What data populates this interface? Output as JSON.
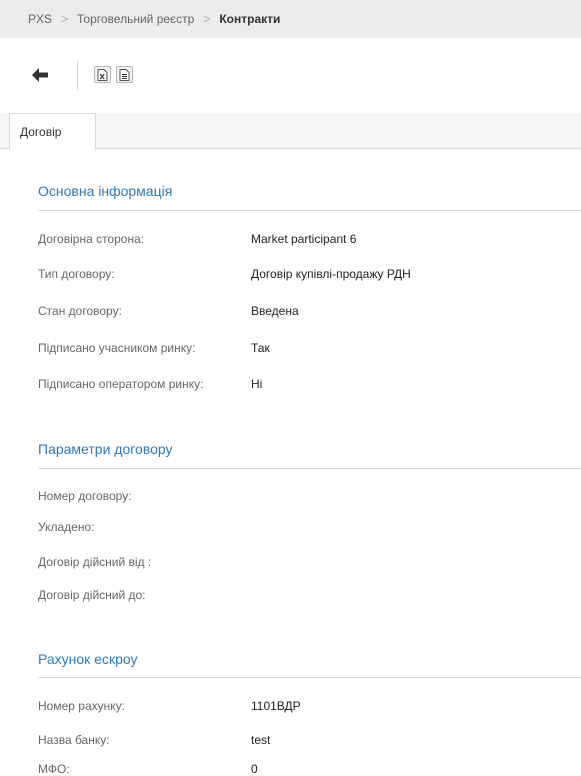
{
  "breadcrumb": {
    "items": [
      "PXS",
      "Торговельний реєстр"
    ],
    "current": "Контракти",
    "separator": ">"
  },
  "toolbar": {
    "back_icon": "arrow-left-icon",
    "excel_icon": "excel-export-icon",
    "doc_icon": "document-icon"
  },
  "tabs": [
    {
      "label": "Договір"
    }
  ],
  "sections": {
    "main": {
      "title": "Основна інформація",
      "rows": [
        {
          "label": "Договірна сторона:",
          "value": "Market participant 6"
        },
        {
          "label": "Тип договору:",
          "value": "Договір купівлі-продажу РДН"
        },
        {
          "label": "Стан договору:",
          "value": "Введена"
        },
        {
          "label": "Підписано учасником ринку:",
          "value": "Так"
        },
        {
          "label": "Підписано оператором ринку:",
          "value": "Ні"
        }
      ]
    },
    "params": {
      "title": "Параметри договору",
      "rows": [
        {
          "label": "Номер договору:",
          "value": ""
        },
        {
          "label": "Укладено:",
          "value": ""
        },
        {
          "label": "Договір дійсний від :",
          "value": ""
        },
        {
          "label": "Договір дійсний до:",
          "value": ""
        }
      ]
    },
    "escrow": {
      "title": "Рахунок ескроу",
      "rows": [
        {
          "label": "Номер рахунку:",
          "value": "1101ВДР"
        },
        {
          "label": "Назва банку:",
          "value": "test"
        },
        {
          "label": "МФО:",
          "value": "0"
        }
      ]
    }
  },
  "colors": {
    "section_title": "#2f7ab5",
    "breadcrumb_bg": "#ececec"
  }
}
